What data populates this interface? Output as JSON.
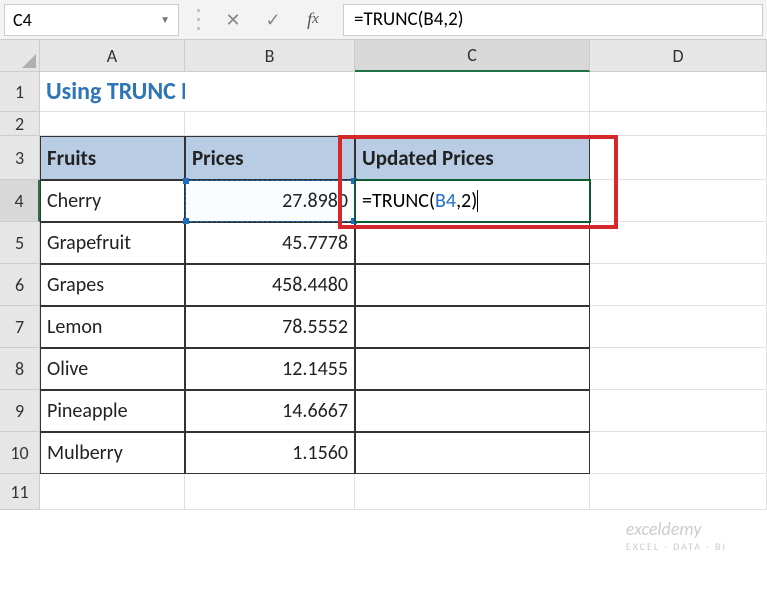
{
  "name_box": "C4",
  "formula_bar_text": "=TRUNC(B4,2)",
  "columns": [
    "A",
    "B",
    "C",
    "D"
  ],
  "rows": [
    "1",
    "2",
    "3",
    "4",
    "5",
    "6",
    "7",
    "8",
    "9",
    "10",
    "11"
  ],
  "title": "Using TRUNC Function",
  "headers": {
    "fruits": "Fruits",
    "prices": "Prices",
    "updated": "Updated Prices"
  },
  "active_formula_prefix": "=TRUNC(",
  "active_formula_ref": "B4",
  "active_formula_suffix": ",2)",
  "data": [
    {
      "fruit": "Cherry",
      "price": "27.8980"
    },
    {
      "fruit": "Grapefruit",
      "price": "45.7778"
    },
    {
      "fruit": "Grapes",
      "price": "458.4480"
    },
    {
      "fruit": "Lemon",
      "price": "78.5552"
    },
    {
      "fruit": "Olive",
      "price": "12.1455"
    },
    {
      "fruit": "Pineapple",
      "price": "14.6667"
    },
    {
      "fruit": "Mulberry",
      "price": "1.1560"
    }
  ],
  "watermark": "exceldemy",
  "watermark_sub": "EXCEL · DATA · BI",
  "chart_data": {
    "type": "table",
    "title": "Using TRUNC Function",
    "columns": [
      "Fruits",
      "Prices",
      "Updated Prices"
    ],
    "rows": [
      [
        "Cherry",
        27.898,
        "=TRUNC(B4,2)"
      ],
      [
        "Grapefruit",
        45.7778,
        null
      ],
      [
        "Grapes",
        458.448,
        null
      ],
      [
        "Lemon",
        78.5552,
        null
      ],
      [
        "Olive",
        12.1455,
        null
      ],
      [
        "Pineapple",
        14.6667,
        null
      ],
      [
        "Mulberry",
        1.156,
        null
      ]
    ],
    "active_cell": "C4",
    "referenced_cell": "B4"
  }
}
